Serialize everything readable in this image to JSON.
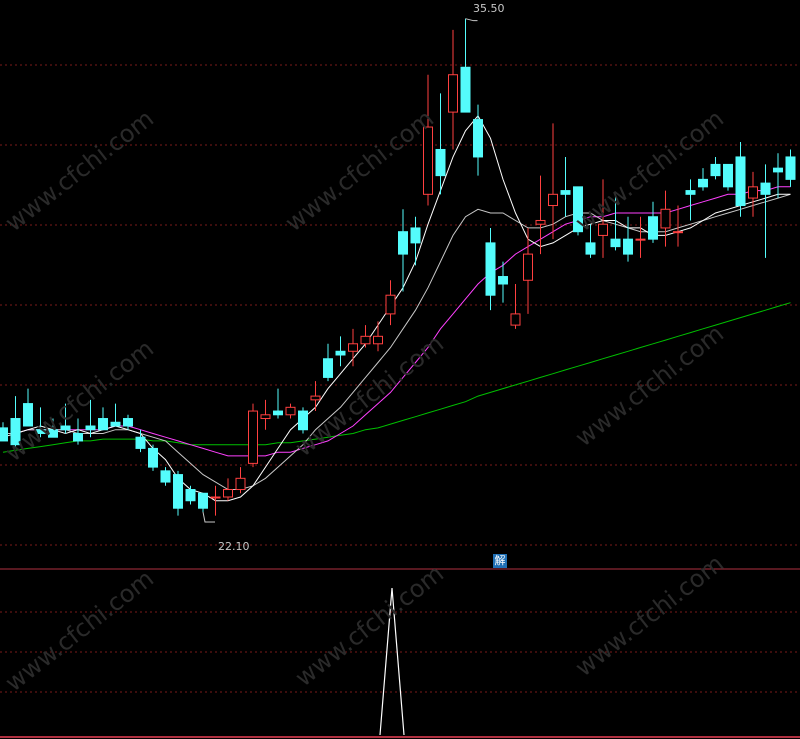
{
  "chart_data": {
    "type": "candlestick",
    "price_ylim": [
      20.8,
      36.0
    ],
    "indicator_ylim": [
      0,
      1
    ],
    "annotations": {
      "high_label": "35.50",
      "low_label": "22.10"
    },
    "signal_badge": "解",
    "watermark": "www.cfchi.com",
    "colors": {
      "up": "#ff4040",
      "down": "#54fcfc",
      "ma_short": "#ffffff",
      "ma_mid": "#c8c8c8",
      "ma_long": "#ff40ff",
      "ma_longer": "#00c000",
      "grid": "#7a1a1a",
      "divider": "#b03040",
      "indicator": "#ffffff"
    },
    "candles": [
      [
        24.55,
        24.7,
        24.2,
        24.4
      ],
      [
        24.8,
        25.4,
        24.1,
        24.0
      ],
      [
        25.2,
        25.6,
        24.6,
        24.8
      ],
      [
        24.5,
        25.1,
        24.4,
        24.3
      ],
      [
        24.5,
        24.8,
        24.3,
        24.3
      ],
      [
        24.6,
        25.2,
        24.5,
        24.4
      ],
      [
        24.4,
        24.8,
        24.2,
        24.1
      ],
      [
        24.6,
        25.3,
        24.5,
        24.3
      ],
      [
        24.8,
        25.1,
        24.5,
        24.5
      ],
      [
        24.7,
        25.2,
        24.6,
        24.6
      ],
      [
        24.8,
        24.9,
        24.6,
        24.5
      ],
      [
        24.3,
        24.5,
        24.0,
        23.9
      ],
      [
        24.0,
        24.1,
        23.5,
        23.4
      ],
      [
        23.4,
        23.5,
        23.1,
        23.0
      ],
      [
        23.3,
        23.4,
        22.4,
        22.2
      ],
      [
        22.9,
        23.0,
        22.6,
        22.5
      ],
      [
        22.8,
        22.8,
        22.4,
        22.3
      ],
      [
        22.7,
        23.0,
        22.7,
        22.2
      ],
      [
        22.7,
        23.2,
        22.9,
        22.6
      ],
      [
        22.9,
        23.5,
        23.2,
        22.8
      ],
      [
        23.6,
        25.2,
        25.0,
        23.5
      ],
      [
        24.8,
        25.3,
        24.9,
        24.5
      ],
      [
        25.0,
        25.6,
        24.9,
        24.8
      ],
      [
        24.9,
        25.2,
        25.1,
        24.8
      ],
      [
        25.0,
        25.1,
        24.5,
        24.4
      ],
      [
        25.3,
        25.8,
        25.4,
        25.0
      ],
      [
        26.4,
        26.8,
        25.9,
        25.8
      ],
      [
        26.6,
        27.0,
        26.5,
        26.2
      ],
      [
        26.6,
        27.2,
        26.8,
        26.2
      ],
      [
        26.8,
        27.3,
        27.0,
        26.7
      ],
      [
        26.8,
        27.4,
        27.0,
        26.6
      ],
      [
        27.6,
        28.5,
        28.1,
        27.3
      ],
      [
        29.8,
        30.4,
        29.2,
        28.2
      ],
      [
        29.9,
        30.2,
        29.5,
        28.9
      ],
      [
        30.8,
        34.0,
        32.6,
        30.5
      ],
      [
        32.0,
        33.5,
        31.3,
        30.8
      ],
      [
        33.0,
        35.2,
        34.0,
        32.0
      ],
      [
        34.2,
        35.5,
        33.0,
        33.0
      ],
      [
        32.8,
        33.2,
        31.8,
        31.3
      ],
      [
        29.5,
        29.9,
        28.1,
        27.7
      ],
      [
        28.6,
        29.0,
        28.4,
        27.9
      ],
      [
        27.3,
        28.4,
        27.6,
        27.2
      ],
      [
        28.5,
        29.9,
        29.2,
        27.6
      ],
      [
        30.0,
        31.3,
        30.1,
        29.2
      ],
      [
        30.5,
        32.7,
        30.8,
        29.6
      ],
      [
        30.9,
        31.8,
        30.8,
        30.2
      ],
      [
        31.0,
        30.8,
        29.8,
        29.7
      ],
      [
        29.5,
        30.0,
        29.2,
        29.1
      ],
      [
        29.7,
        31.2,
        30.0,
        29.1
      ],
      [
        29.6,
        30.8,
        29.4,
        29.3
      ],
      [
        29.6,
        30.2,
        29.2,
        29.0
      ],
      [
        29.6,
        30.2,
        29.6,
        29.1
      ],
      [
        30.2,
        30.6,
        29.6,
        29.5
      ],
      [
        29.9,
        30.9,
        30.4,
        29.4
      ],
      [
        29.8,
        30.5,
        29.8,
        29.4
      ],
      [
        30.9,
        31.2,
        30.8,
        30.1
      ],
      [
        31.2,
        31.5,
        31.0,
        30.9
      ],
      [
        31.6,
        31.8,
        31.3,
        31.2
      ],
      [
        31.6,
        31.5,
        31.0,
        30.9
      ],
      [
        31.8,
        32.2,
        30.5,
        30.2
      ],
      [
        30.7,
        31.4,
        31.0,
        30.2
      ],
      [
        31.1,
        31.6,
        30.8,
        29.1
      ],
      [
        31.5,
        31.9,
        31.4,
        30.7
      ],
      [
        31.8,
        32.0,
        31.2,
        31.0
      ]
    ],
    "ma_short": [
      24.3,
      24.4,
      24.5,
      24.6,
      24.5,
      24.4,
      24.5,
      24.4,
      24.5,
      24.6,
      24.5,
      24.4,
      24.0,
      23.7,
      23.2,
      22.9,
      22.8,
      22.6,
      22.6,
      22.7,
      23.0,
      23.5,
      24.0,
      24.5,
      24.8,
      25.1,
      25.6,
      26.0,
      26.4,
      26.8,
      27.3,
      27.8,
      28.3,
      29.0,
      30.0,
      30.9,
      31.8,
      32.5,
      32.9,
      32.3,
      31.2,
      30.3,
      29.6,
      29.4,
      29.5,
      29.7,
      29.9,
      30.0,
      30.1,
      30.1,
      29.9,
      29.9,
      29.7,
      29.7,
      29.8,
      29.9,
      30.1,
      30.3,
      30.4,
      30.5,
      30.6,
      30.7,
      30.8,
      30.8
    ],
    "ma_mid": [
      24.4,
      24.4,
      24.5,
      24.5,
      24.5,
      24.5,
      24.4,
      24.4,
      24.4,
      24.5,
      24.5,
      24.4,
      24.3,
      24.2,
      23.9,
      23.6,
      23.3,
      23.1,
      22.9,
      22.9,
      23.0,
      23.2,
      23.5,
      23.8,
      24.1,
      24.5,
      24.8,
      25.1,
      25.5,
      25.9,
      26.3,
      26.7,
      27.2,
      27.7,
      28.3,
      29.0,
      29.7,
      30.2,
      30.4,
      30.3,
      30.3,
      30.1,
      29.9,
      29.9,
      30.0,
      30.2,
      30.3,
      30.3,
      30.1,
      30.0,
      29.9,
      29.8,
      29.8,
      29.8,
      29.9,
      30.0,
      30.1,
      30.2,
      30.3,
      30.4,
      30.5,
      30.6,
      30.7,
      30.8
    ],
    "ma_long": [
      24.4,
      24.4,
      24.5,
      24.5,
      24.5,
      24.5,
      24.5,
      24.5,
      24.5,
      24.6,
      24.6,
      24.5,
      24.4,
      24.3,
      24.2,
      24.1,
      24.0,
      23.9,
      23.8,
      23.8,
      23.8,
      23.8,
      23.9,
      23.9,
      24.0,
      24.1,
      24.2,
      24.4,
      24.6,
      24.9,
      25.2,
      25.5,
      25.9,
      26.3,
      26.7,
      27.2,
      27.6,
      28.0,
      28.4,
      28.7,
      28.9,
      29.2,
      29.4,
      29.6,
      29.8,
      30.0,
      30.1,
      30.2,
      30.2,
      30.3,
      30.3,
      30.3,
      30.3,
      30.3,
      30.4,
      30.5,
      30.6,
      30.7,
      30.8,
      30.8,
      30.9,
      30.9,
      31.0,
      31.0
    ],
    "ma_longer": [
      23.9,
      23.95,
      24.0,
      24.05,
      24.1,
      24.15,
      24.2,
      24.2,
      24.25,
      24.25,
      24.25,
      24.25,
      24.2,
      24.2,
      24.15,
      24.1,
      24.1,
      24.1,
      24.1,
      24.1,
      24.1,
      24.1,
      24.15,
      24.15,
      24.2,
      24.25,
      24.3,
      24.35,
      24.4,
      24.5,
      24.55,
      24.65,
      24.75,
      24.85,
      24.95,
      25.05,
      25.15,
      25.25,
      25.4,
      25.5,
      25.6,
      25.7,
      25.8,
      25.9,
      26.0,
      26.1,
      26.2,
      26.3,
      26.4,
      26.5,
      26.6,
      26.7,
      26.8,
      26.9,
      27.0,
      27.1,
      27.2,
      27.3,
      27.4,
      27.5,
      27.6,
      27.7,
      27.8,
      27.9
    ],
    "indicator": {
      "spike_index": 28,
      "spike_value": 1
    }
  }
}
